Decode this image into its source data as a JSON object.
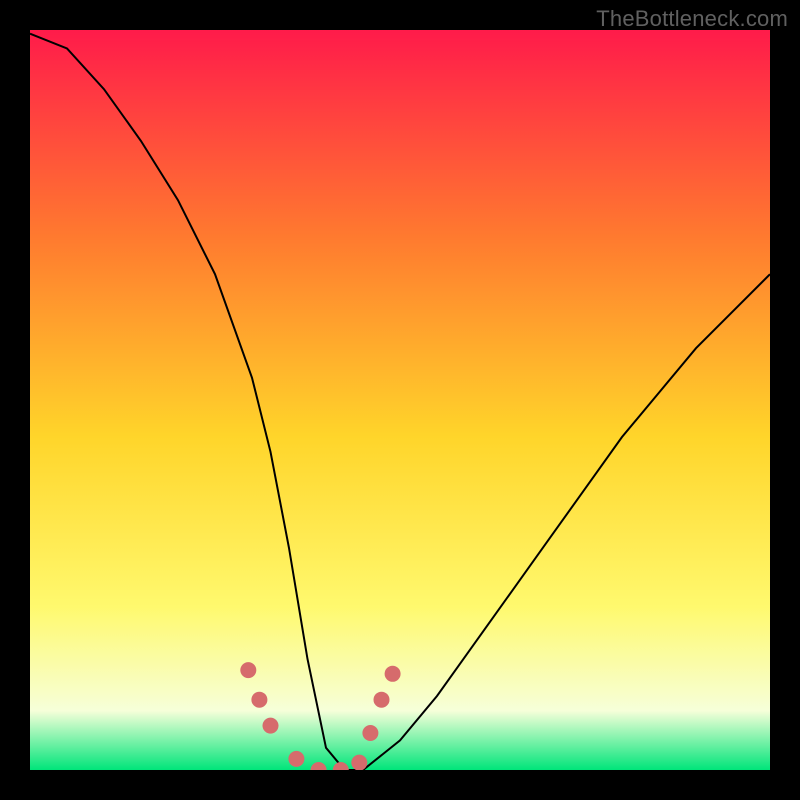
{
  "watermark": "TheBottleneck.com",
  "colors": {
    "frame_bg": "#000000",
    "gradient_top": "#ff1b4a",
    "gradient_mid1": "#ff7a2f",
    "gradient_mid2": "#ffd52a",
    "gradient_mid3": "#fff96e",
    "gradient_low": "#f6ffd9",
    "gradient_bottom": "#00e57a",
    "curve_color": "#000000",
    "curve_width": 2.0,
    "marker_color": "#d66b6c",
    "marker_radius": 8
  },
  "chart_data": {
    "type": "line",
    "title": "",
    "xlabel": "",
    "ylabel": "",
    "xlim": [
      0,
      1
    ],
    "ylim": [
      0,
      1
    ],
    "x": [
      0.0,
      0.05,
      0.1,
      0.15,
      0.2,
      0.25,
      0.3,
      0.325,
      0.35,
      0.375,
      0.4,
      0.425,
      0.45,
      0.5,
      0.55,
      0.6,
      0.65,
      0.7,
      0.75,
      0.8,
      0.85,
      0.9,
      0.95,
      1.0
    ],
    "values": [
      0.995,
      0.975,
      0.92,
      0.85,
      0.77,
      0.67,
      0.53,
      0.43,
      0.3,
      0.15,
      0.03,
      0.0,
      0.0,
      0.04,
      0.1,
      0.17,
      0.24,
      0.31,
      0.38,
      0.45,
      0.51,
      0.57,
      0.62,
      0.67
    ],
    "markers": {
      "x": [
        0.295,
        0.31,
        0.325,
        0.36,
        0.39,
        0.42,
        0.445,
        0.46,
        0.475,
        0.49
      ],
      "y": [
        0.135,
        0.095,
        0.06,
        0.015,
        0.0,
        0.0,
        0.01,
        0.05,
        0.095,
        0.13
      ]
    }
  }
}
